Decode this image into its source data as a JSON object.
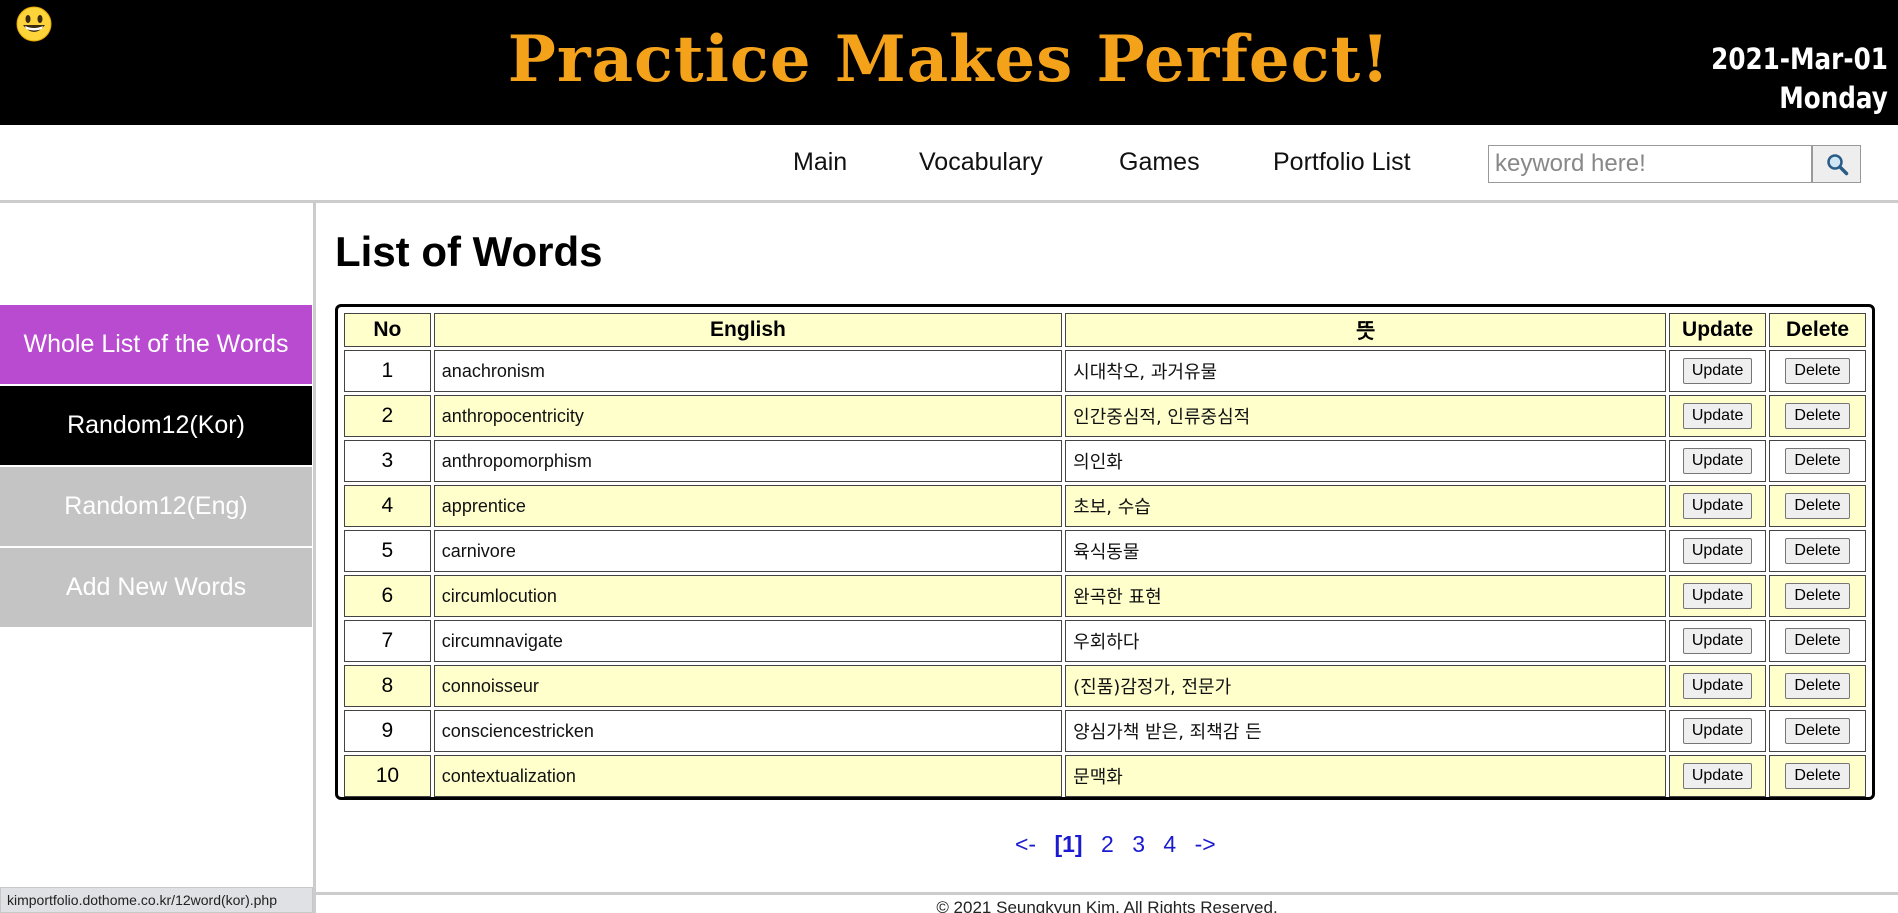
{
  "header": {
    "emoji_icon": "grinning-face-icon",
    "title": "Practice Makes Perfect!",
    "date": "2021-Mar-01",
    "weekday": "Monday",
    "title_color": "#f5a21b"
  },
  "nav": {
    "items": [
      {
        "label": "Main"
      },
      {
        "label": "Vocabulary"
      },
      {
        "label": "Games"
      },
      {
        "label": "Portfolio List"
      }
    ],
    "search": {
      "placeholder": "keyword here!",
      "value": "",
      "icon": "magnifier-icon"
    }
  },
  "sidebar": {
    "items": [
      {
        "label": "Whole List of the Words",
        "color": "#b84bd0"
      },
      {
        "label": "Random12(Kor)",
        "color": "#000000"
      },
      {
        "label": "Random12(Eng)",
        "color": "#c4c4c4"
      },
      {
        "label": "Add New Words",
        "color": "#c4c4c4"
      }
    ]
  },
  "main": {
    "title": "List of Words",
    "table": {
      "headers": [
        "No",
        "English",
        "뜻",
        "Update",
        "Delete"
      ],
      "rows": [
        {
          "no": "1",
          "english": "anachronism",
          "meaning": "시대착오, 과거유물",
          "update": "Update",
          "delete": "Delete"
        },
        {
          "no": "2",
          "english": "anthropocentricity",
          "meaning": "인간중심적, 인류중심적",
          "update": "Update",
          "delete": "Delete"
        },
        {
          "no": "3",
          "english": "anthropomorphism",
          "meaning": "의인화",
          "update": "Update",
          "delete": "Delete"
        },
        {
          "no": "4",
          "english": "apprentice",
          "meaning": "초보, 수습",
          "update": "Update",
          "delete": "Delete"
        },
        {
          "no": "5",
          "english": "carnivore",
          "meaning": "육식동물",
          "update": "Update",
          "delete": "Delete"
        },
        {
          "no": "6",
          "english": "circumlocution",
          "meaning": "완곡한 표현",
          "update": "Update",
          "delete": "Delete"
        },
        {
          "no": "7",
          "english": "circumnavigate",
          "meaning": "우회하다",
          "update": "Update",
          "delete": "Delete"
        },
        {
          "no": "8",
          "english": "connoisseur",
          "meaning": "(진품)감정가, 전문가",
          "update": "Update",
          "delete": "Delete"
        },
        {
          "no": "9",
          "english": "consciencestricken",
          "meaning": "양심가책 받은, 죄책감 든",
          "update": "Update",
          "delete": "Delete"
        },
        {
          "no": "10",
          "english": "contextualization",
          "meaning": "문맥화",
          "update": "Update",
          "delete": "Delete"
        }
      ]
    },
    "pagination": {
      "prev": "<-",
      "current": "[1]",
      "pages": [
        "2",
        "3",
        "4"
      ],
      "next": "->"
    }
  },
  "footer": {
    "text": "© 2021 Seungkyun Kim. All Rights Reserved."
  },
  "statusbar": {
    "url": "kimportfolio.dothome.co.kr/12word(kor).php"
  }
}
